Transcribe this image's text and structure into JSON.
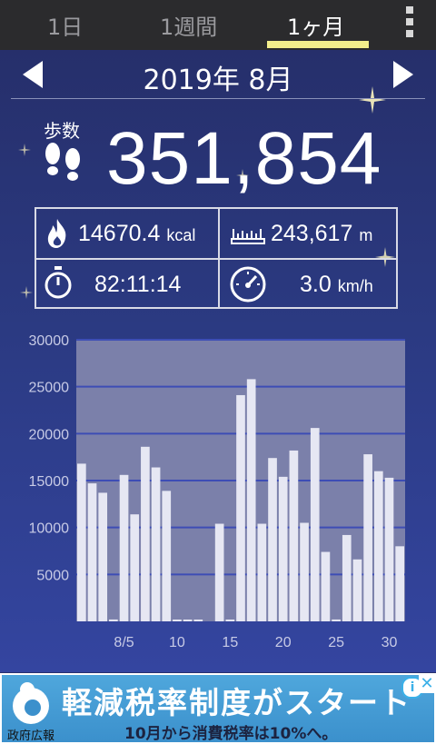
{
  "tabs": [
    {
      "label": "1日",
      "active": false
    },
    {
      "label": "1週間",
      "active": false
    },
    {
      "label": "1ヶ月",
      "active": true
    }
  ],
  "month_nav": {
    "title": "2019年 8月"
  },
  "steps": {
    "label": "歩数",
    "value": "351,854"
  },
  "stats": {
    "calories": {
      "value": "14670.4",
      "unit": "kcal"
    },
    "distance": {
      "value": "243,617",
      "unit": "m"
    },
    "duration": {
      "value": "82:11:14"
    },
    "speed": {
      "value": "3.0",
      "unit": "km/h"
    }
  },
  "chart_data": {
    "type": "bar",
    "y_ticks": [
      "30000",
      "25000",
      "20000",
      "15000",
      "10000",
      "5000"
    ],
    "ylim": [
      0,
      30000
    ],
    "x_tick_labels": [
      {
        "day": 5,
        "label": "8/5"
      },
      {
        "day": 10,
        "label": "10"
      },
      {
        "day": 15,
        "label": "15"
      },
      {
        "day": 20,
        "label": "20"
      },
      {
        "day": 25,
        "label": "25"
      },
      {
        "day": 30,
        "label": "30"
      }
    ],
    "days": [
      1,
      2,
      3,
      4,
      5,
      6,
      7,
      8,
      9,
      10,
      11,
      12,
      13,
      14,
      15,
      16,
      17,
      18,
      19,
      20,
      21,
      22,
      23,
      24,
      25,
      26,
      27,
      28,
      29,
      30,
      31
    ],
    "values": [
      16800,
      14700,
      13700,
      200,
      15600,
      11400,
      18600,
      16400,
      13900,
      100,
      100,
      100,
      0,
      10400,
      100,
      24100,
      25800,
      10400,
      17400,
      15400,
      18200,
      10500,
      20600,
      7400,
      200,
      9200,
      6600,
      17800,
      16000,
      15300,
      8000
    ],
    "colors": {
      "plot_bg": "#7b80aa",
      "bar": "#e6e7f3",
      "grid": "#3d4db5"
    }
  },
  "ad": {
    "headline": "軽減税率制度がスタート",
    "subline": "10月から消費税率は10%へ。",
    "brand": "政府広報",
    "info": "i",
    "close": "✕"
  }
}
